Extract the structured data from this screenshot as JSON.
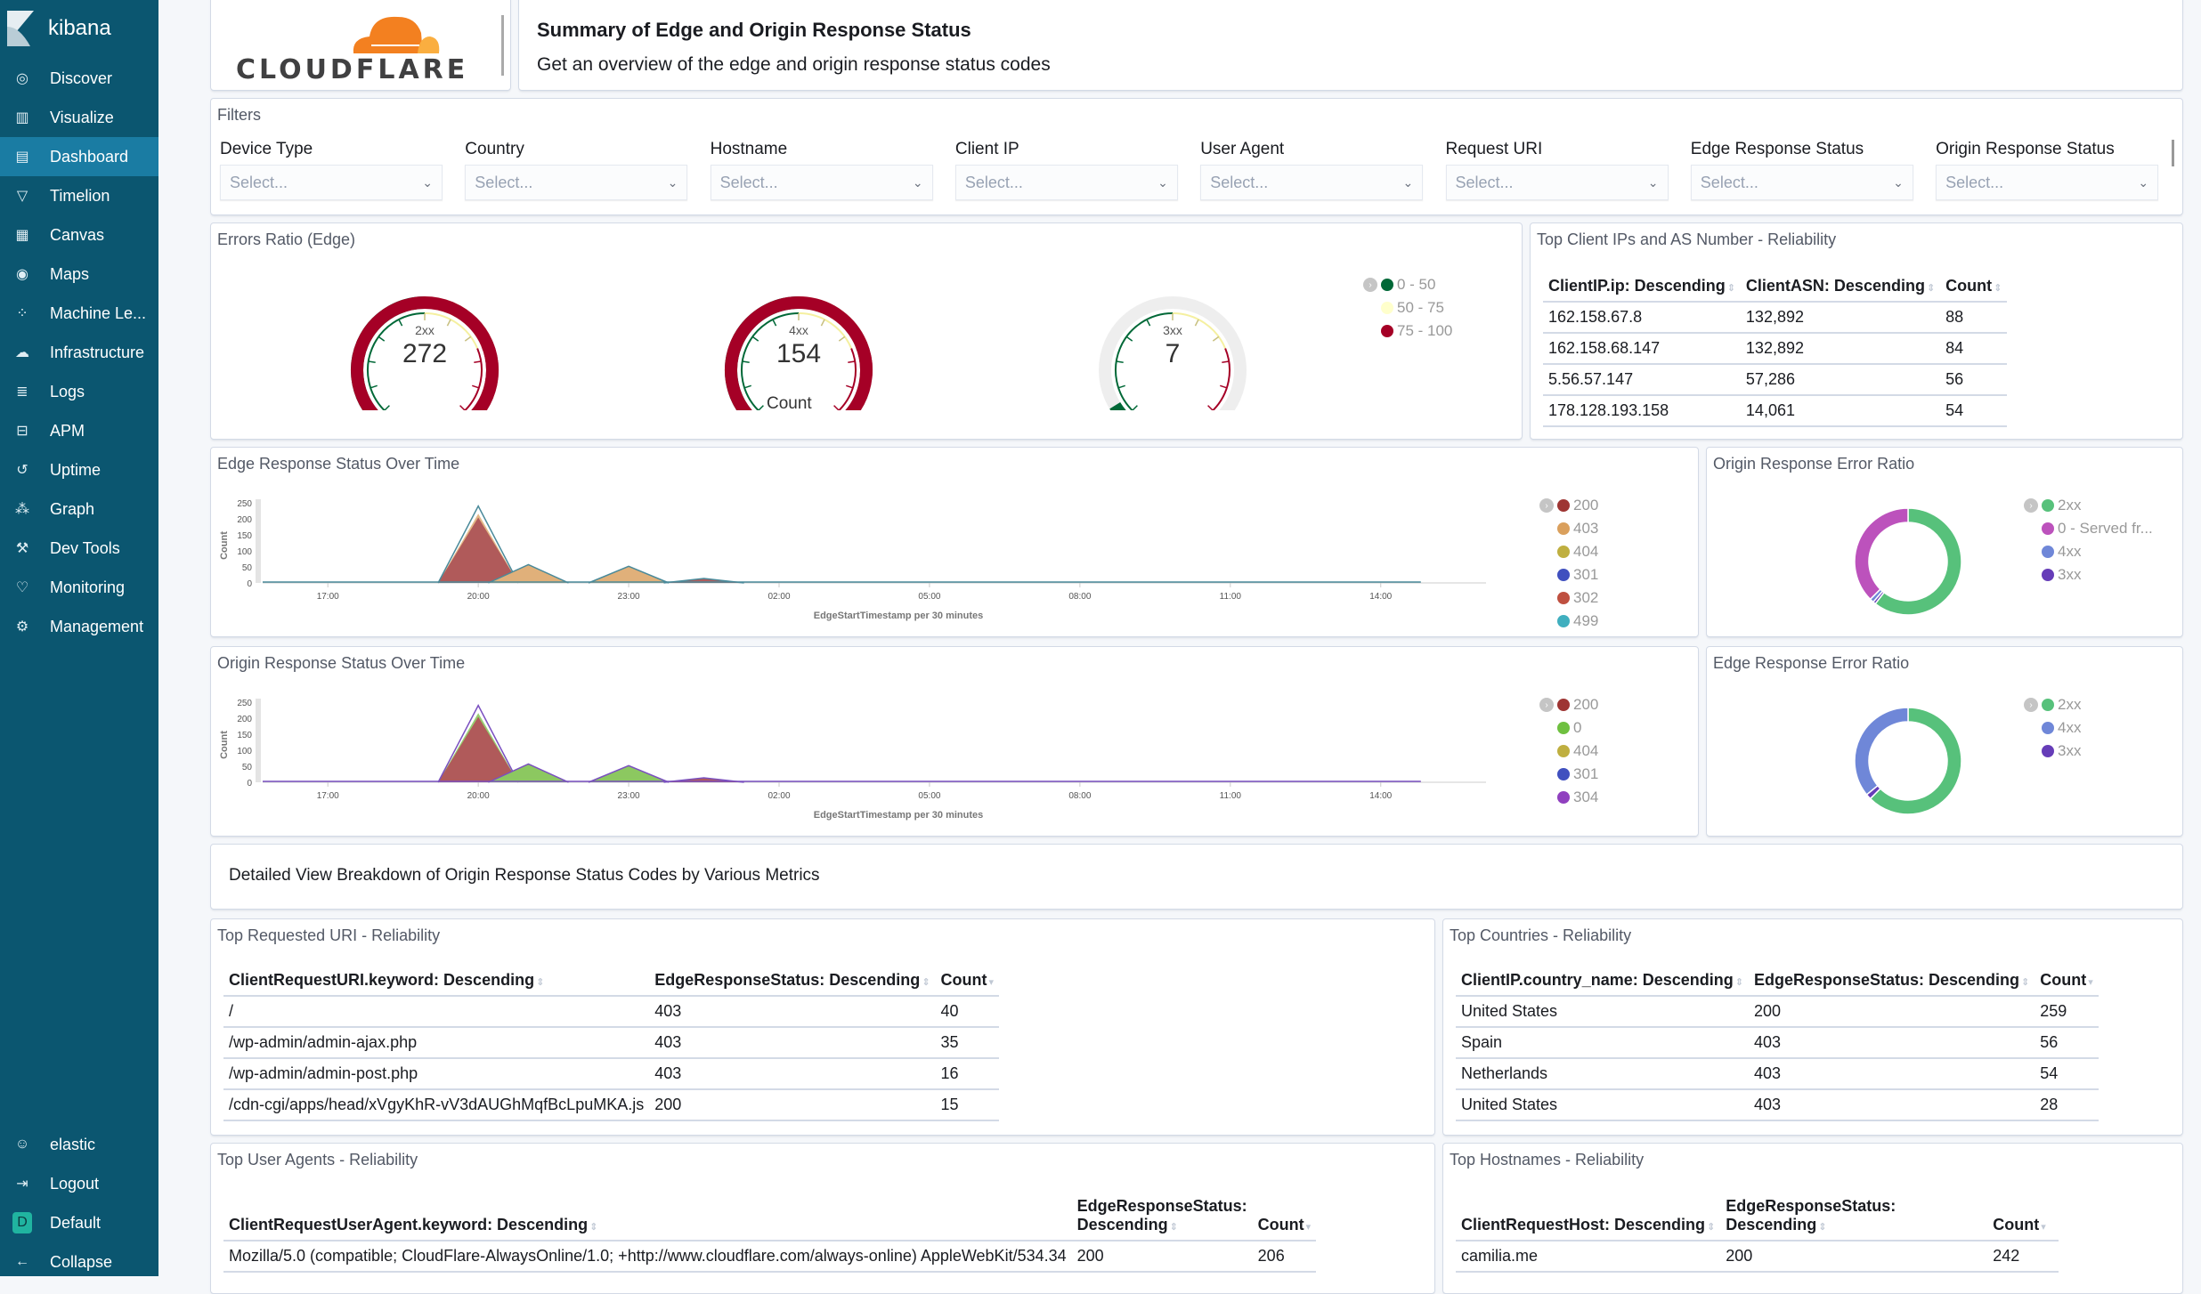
{
  "app": {
    "name": "kibana"
  },
  "sidebar": {
    "items": [
      {
        "label": "Discover",
        "icon": "compass-icon"
      },
      {
        "label": "Visualize",
        "icon": "visualize-icon"
      },
      {
        "label": "Dashboard",
        "icon": "dashboard-icon",
        "active": true
      },
      {
        "label": "Timelion",
        "icon": "timelion-icon"
      },
      {
        "label": "Canvas",
        "icon": "canvas-icon"
      },
      {
        "label": "Maps",
        "icon": "maps-icon"
      },
      {
        "label": "Machine Le...",
        "icon": "machine-learning-icon"
      },
      {
        "label": "Infrastructure",
        "icon": "infrastructure-icon"
      },
      {
        "label": "Logs",
        "icon": "logs-icon"
      },
      {
        "label": "APM",
        "icon": "apm-icon"
      },
      {
        "label": "Uptime",
        "icon": "uptime-icon"
      },
      {
        "label": "Graph",
        "icon": "graph-icon"
      },
      {
        "label": "Dev Tools",
        "icon": "dev-tools-icon"
      },
      {
        "label": "Monitoring",
        "icon": "monitoring-icon"
      },
      {
        "label": "Management",
        "icon": "gear-icon"
      }
    ],
    "bottom": [
      {
        "label": "elastic",
        "icon": "user-icon"
      },
      {
        "label": "Logout",
        "icon": "logout-icon"
      },
      {
        "label": "Default",
        "icon": "space-badge",
        "badge": "D"
      },
      {
        "label": "Collapse",
        "icon": "arrow-left-icon"
      }
    ]
  },
  "header": {
    "logo_text": "CLOUDFLARE",
    "title": "Summary of Edge and Origin Response Status",
    "subtitle": "Get an overview of the edge and origin response status codes"
  },
  "filters": {
    "title": "Filters",
    "controls": [
      {
        "label": "Device Type",
        "placeholder": "Select..."
      },
      {
        "label": "Country",
        "placeholder": "Select..."
      },
      {
        "label": "Hostname",
        "placeholder": "Select..."
      },
      {
        "label": "Client IP",
        "placeholder": "Select..."
      },
      {
        "label": "User Agent",
        "placeholder": "Select..."
      },
      {
        "label": "Request URI",
        "placeholder": "Select..."
      },
      {
        "label": "Edge Response Status",
        "placeholder": "Select..."
      },
      {
        "label": "Origin Response Status",
        "placeholder": "Select..."
      }
    ]
  },
  "gauges": {
    "title": "Errors Ratio (Edge)",
    "count_label": "Count",
    "items": [
      {
        "label": "2xx",
        "value": "272"
      },
      {
        "label": "4xx",
        "value": "154"
      },
      {
        "label": "3xx",
        "value": "7"
      }
    ],
    "legend": [
      {
        "label": "0 - 50",
        "color": "#006837"
      },
      {
        "label": "50 - 75",
        "color": "#ffffcc"
      },
      {
        "label": "75 - 100",
        "color": "#a50026"
      }
    ]
  },
  "client_ips": {
    "title": "Top Client IPs and AS Number - Reliability",
    "columns": [
      "ClientIP.ip: Descending",
      "ClientASN: Descending",
      "Count"
    ],
    "rows": [
      [
        "162.158.67.8",
        "132,892",
        "88"
      ],
      [
        "162.158.68.147",
        "132,892",
        "84"
      ],
      [
        "5.56.57.147",
        "57,286",
        "56"
      ],
      [
        "178.128.193.158",
        "14,061",
        "54"
      ]
    ]
  },
  "chart_data": [
    {
      "type": "area",
      "title": "Edge Response Status Over Time",
      "xlabel": "EdgeStartTimestamp per 30 minutes",
      "ylabel": "Count",
      "ylim": [
        0,
        250
      ],
      "yticks": [
        "0",
        "50",
        "100",
        "150",
        "200",
        "250"
      ],
      "xticks": [
        "17:00",
        "20:00",
        "23:00",
        "02:00",
        "05:00",
        "08:00",
        "11:00",
        "14:00"
      ],
      "legend": [
        {
          "name": "200",
          "color": "#9e3533"
        },
        {
          "name": "403",
          "color": "#daa05d"
        },
        {
          "name": "404",
          "color": "#bfaf40"
        },
        {
          "name": "301",
          "color": "#4050bf"
        },
        {
          "name": "302",
          "color": "#bf5040"
        },
        {
          "name": "499",
          "color": "#40afbf"
        }
      ],
      "series": [
        {
          "name": "200",
          "points": [
            [
              16.5,
              2
            ],
            [
              17,
              2
            ],
            [
              19.5,
              0
            ],
            [
              20,
              215
            ],
            [
              20.5,
              0
            ],
            [
              21,
              3
            ],
            [
              21.5,
              3
            ],
            [
              0.5,
              10
            ],
            [
              1,
              3
            ]
          ]
        },
        {
          "name": "403",
          "points": [
            [
              19.5,
              0
            ],
            [
              20,
              20
            ],
            [
              20.5,
              2
            ],
            [
              21,
              55
            ],
            [
              21.5,
              5
            ],
            [
              22.5,
              0
            ],
            [
              23,
              50
            ],
            [
              23.5,
              2
            ]
          ]
        }
      ],
      "peaks": [
        {
          "x": "20:00",
          "total": 240
        },
        {
          "x": "21:00",
          "total": 57
        },
        {
          "x": "23:00",
          "total": 52
        },
        {
          "x": "00:30",
          "total": 14
        }
      ]
    },
    {
      "type": "area",
      "title": "Origin Response Status Over Time",
      "xlabel": "EdgeStartTimestamp per 30 minutes",
      "ylabel": "Count",
      "ylim": [
        0,
        250
      ],
      "yticks": [
        "0",
        "50",
        "100",
        "150",
        "200",
        "250"
      ],
      "xticks": [
        "17:00",
        "20:00",
        "23:00",
        "02:00",
        "05:00",
        "08:00",
        "11:00",
        "14:00"
      ],
      "legend": [
        {
          "name": "200",
          "color": "#9e3533"
        },
        {
          "name": "0",
          "color": "#6fc040"
        },
        {
          "name": "404",
          "color": "#bfaf40"
        },
        {
          "name": "301",
          "color": "#4050bf"
        },
        {
          "name": "304",
          "color": "#9040bf"
        }
      ],
      "peaks": [
        {
          "x": "20:00",
          "total": 240
        },
        {
          "x": "21:00",
          "total": 57
        },
        {
          "x": "23:00",
          "total": 52
        },
        {
          "x": "00:30",
          "total": 14
        }
      ]
    },
    {
      "type": "pie",
      "title": "Origin Response Error Ratio",
      "donut": true,
      "slices": [
        {
          "label": "2xx",
          "value": 60.5,
          "color": "#57c17b"
        },
        {
          "label": "0 - Served fr...",
          "value": 37.5,
          "color": "#bc52bc"
        },
        {
          "label": "4xx",
          "value": 1.2,
          "color": "#6f87d8"
        },
        {
          "label": "3xx",
          "value": 0.8,
          "color": "#663db8"
        }
      ]
    },
    {
      "type": "pie",
      "title": "Edge Response Error Ratio",
      "donut": true,
      "slices": [
        {
          "label": "2xx",
          "value": 62.5,
          "color": "#57c17b"
        },
        {
          "label": "4xx",
          "value": 35.9,
          "color": "#6f87d8"
        },
        {
          "label": "3xx",
          "value": 1.6,
          "color": "#663db8"
        }
      ]
    }
  ],
  "detail": {
    "text": "Detailed View Breakdown of Origin Response Status Codes by Various Metrics"
  },
  "uri_table": {
    "title": "Top Requested URI - Reliability",
    "columns": [
      "ClientRequestURI.keyword: Descending",
      "EdgeResponseStatus: Descending",
      "Count"
    ],
    "rows": [
      [
        "/",
        "403",
        "40"
      ],
      [
        "/wp-admin/admin-ajax.php",
        "403",
        "35"
      ],
      [
        "/wp-admin/admin-post.php",
        "403",
        "16"
      ],
      [
        "/cdn-cgi/apps/head/xVgyKhR-vV3dAUGhMqfBcLpuMKA.js",
        "200",
        "15"
      ]
    ]
  },
  "countries_table": {
    "title": "Top Countries - Reliability",
    "columns": [
      "ClientIP.country_name: Descending",
      "EdgeResponseStatus: Descending",
      "Count"
    ],
    "rows": [
      [
        "United States",
        "200",
        "259"
      ],
      [
        "Spain",
        "403",
        "56"
      ],
      [
        "Netherlands",
        "403",
        "54"
      ],
      [
        "United States",
        "403",
        "28"
      ]
    ]
  },
  "ua_table": {
    "title": "Top User Agents - Reliability",
    "columns": [
      "ClientRequestUserAgent.keyword: Descending",
      "EdgeResponseStatus: Descending",
      "Count"
    ],
    "rows": [
      [
        "Mozilla/5.0 (compatible; CloudFlare-AlwaysOnline/1.0; +http://www.cloudflare.com/always-online) AppleWebKit/534.34",
        "200",
        "206"
      ]
    ]
  },
  "hosts_table": {
    "title": "Top Hostnames - Reliability",
    "columns": [
      "ClientRequestHost: Descending",
      "EdgeResponseStatus: Descending",
      "Count"
    ],
    "rows": [
      [
        "camilia.me",
        "200",
        "242"
      ]
    ]
  }
}
